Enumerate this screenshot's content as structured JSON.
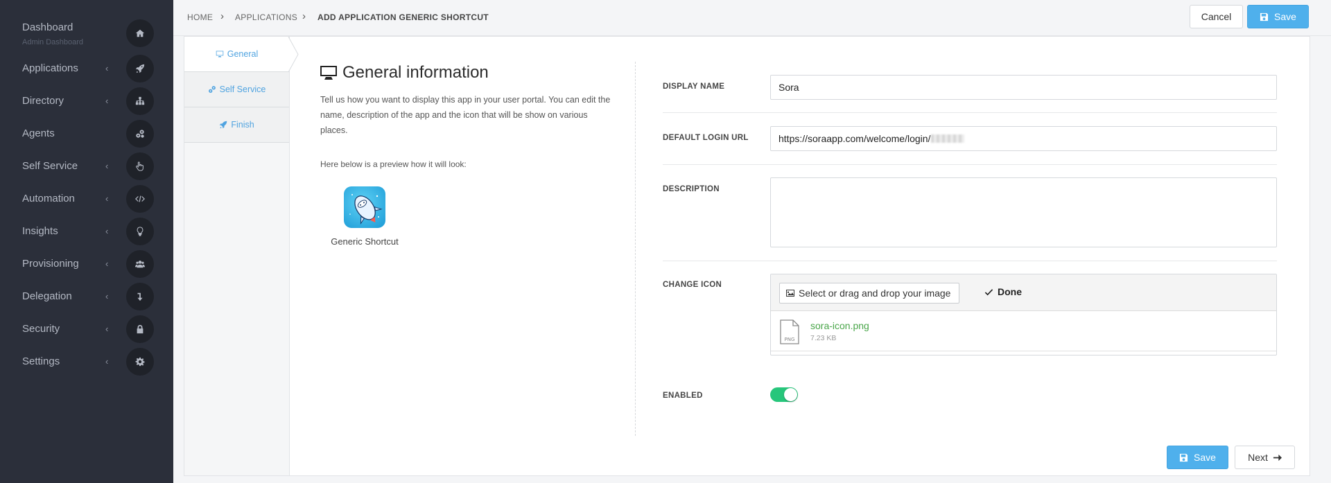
{
  "sidebar": {
    "items": [
      {
        "label": "Dashboard",
        "sub": "Admin Dashboard",
        "icon": "home-icon",
        "chevron": ""
      },
      {
        "label": "Applications",
        "icon": "rocket-icon",
        "chevron": "‹"
      },
      {
        "label": "Directory",
        "icon": "sitemap-icon",
        "chevron": "‹"
      },
      {
        "label": "Agents",
        "icon": "cogs-icon",
        "chevron": ""
      },
      {
        "label": "Self Service",
        "icon": "hand-pointer-icon",
        "chevron": "‹"
      },
      {
        "label": "Automation",
        "icon": "code-icon",
        "chevron": "‹"
      },
      {
        "label": "Insights",
        "icon": "lightbulb-icon",
        "chevron": "‹"
      },
      {
        "label": "Provisioning",
        "icon": "users-icon",
        "chevron": "‹"
      },
      {
        "label": "Delegation",
        "icon": "level-down-icon",
        "chevron": "‹"
      },
      {
        "label": "Security",
        "icon": "lock-icon",
        "chevron": "‹"
      },
      {
        "label": "Settings",
        "icon": "gear-icon",
        "chevron": "‹"
      }
    ]
  },
  "breadcrumb": {
    "home": "HOME",
    "applications": "APPLICATIONS",
    "current": "ADD APPLICATION GENERIC SHORTCUT",
    "sep": "›"
  },
  "toolbar": {
    "cancel_label": "Cancel",
    "save_label": "Save"
  },
  "wizard": {
    "steps": [
      {
        "label": "General"
      },
      {
        "label": "Self Service"
      },
      {
        "label": "Finish"
      }
    ]
  },
  "general": {
    "title": "General information",
    "description": "Tell us how you want to display this app in your user portal. You can edit the name, description of the app and the icon that will be show on various places.",
    "preview_label": "Here below is a preview how it will look:",
    "app_caption": "Generic Shortcut"
  },
  "form": {
    "display_name": {
      "label": "DISPLAY NAME",
      "value": "Sora"
    },
    "login_url": {
      "label": "DEFAULT LOGIN URL",
      "value": "https://soraapp.com/welcome/login/"
    },
    "description": {
      "label": "DESCRIPTION",
      "value": ""
    },
    "change_icon": {
      "label": "CHANGE ICON",
      "upload_label": "Select or drag and drop your image",
      "done_label": "Done",
      "file_name": "sora-icon.png",
      "file_size": "7.23 KB",
      "file_type": "PNG"
    },
    "enabled": {
      "label": "ENABLED",
      "value": true
    }
  },
  "footer": {
    "save_label": "Save",
    "next_label": "Next"
  },
  "colors": {
    "sidebar_bg": "#2b2f3a",
    "primary": "#4fb0ec",
    "toggle_on": "#27c67b",
    "file_link": "#4aa64a"
  }
}
